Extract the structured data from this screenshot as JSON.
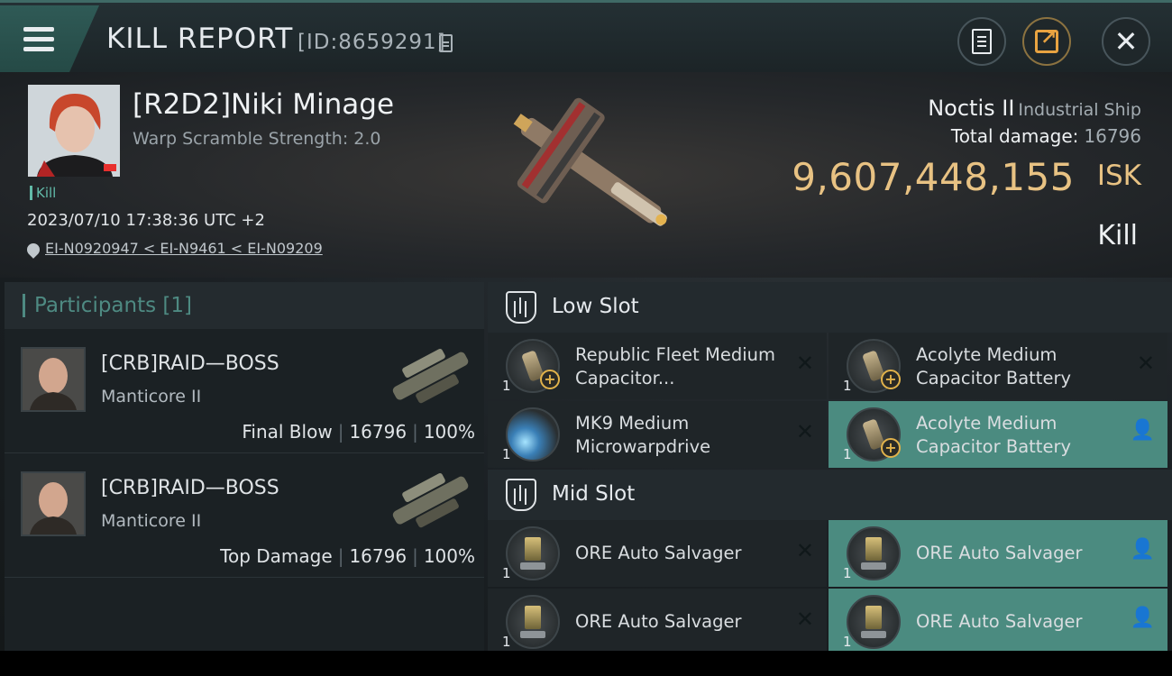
{
  "header": {
    "title": "KILL REPORT",
    "report_id": "[ID:8659291]",
    "icons": {
      "menu": "hamburger-icon",
      "copy": "copy-icon",
      "doc": "document-icon",
      "share": "share-icon",
      "close": "close-icon"
    }
  },
  "victim": {
    "name": "[R2D2]Niki Minage",
    "warp_scramble": "Warp Scramble Strength: 2.0",
    "kill_tag": "Kill",
    "timestamp": "2023/07/10 17:38:36 UTC +2",
    "location": "EI-N0920947 < EI-N9461 < EI-N09209",
    "ship_name": "Noctis II",
    "ship_class": "Industrial Ship",
    "total_damage_label": "Total damage:",
    "total_damage": "16796",
    "isk_value": "9,607,448,155",
    "isk_unit": "ISK",
    "result": "Kill"
  },
  "participants": {
    "title": "Participants",
    "count": "[1]",
    "list": [
      {
        "name": "[CRB]RAID—BOSS",
        "ship": "Manticore II",
        "role": "Final Blow",
        "damage": "16796",
        "percent": "100%"
      },
      {
        "name": "[CRB]RAID—BOSS",
        "ship": "Manticore II",
        "role": "Top Damage",
        "damage": "16796",
        "percent": "100%"
      }
    ]
  },
  "low_slot": {
    "title": "Low Slot",
    "modules": [
      {
        "name": "Republic Fleet Medium Capacitor...",
        "qty": "1",
        "status": "destroyed"
      },
      {
        "name": "Acolyte Medium Capacitor Battery",
        "qty": "1",
        "status": "destroyed"
      },
      {
        "name": "MK9 Medium Microwarpdrive",
        "qty": "1",
        "status": "destroyed"
      },
      {
        "name": "Acolyte Medium Capacitor Battery",
        "qty": "1",
        "status": "dropped"
      }
    ]
  },
  "mid_slot": {
    "title": "Mid Slot",
    "modules": [
      {
        "name": "ORE Auto Salvager",
        "qty": "1",
        "status": "destroyed"
      },
      {
        "name": "ORE Auto Salvager",
        "qty": "1",
        "status": "dropped"
      },
      {
        "name": "ORE Auto Salvager",
        "qty": "1",
        "status": "destroyed"
      },
      {
        "name": "ORE Auto Salvager",
        "qty": "1",
        "status": "dropped"
      }
    ]
  },
  "status_glyphs": {
    "destroyed": "✕",
    "dropped": "👤"
  },
  "colors": {
    "accent": "#4b8b80",
    "isk": "#e8c283",
    "kill_tag": "#62bba9"
  }
}
